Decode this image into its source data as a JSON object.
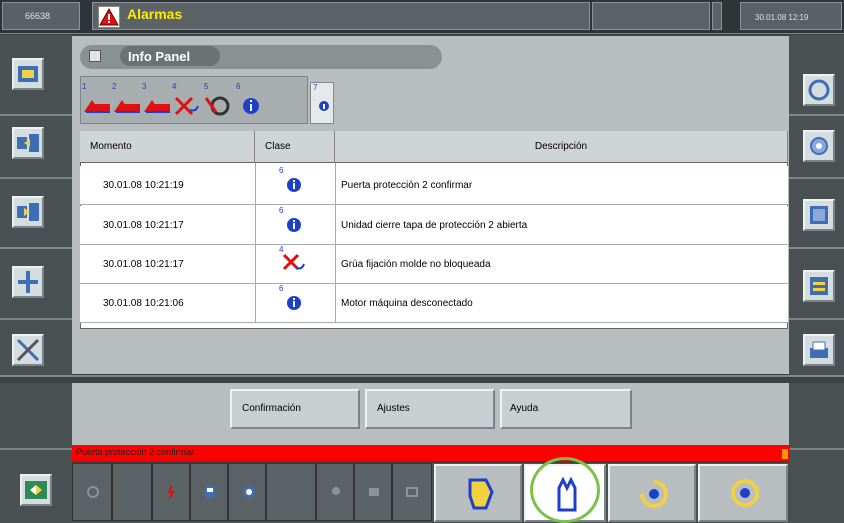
{
  "topbar": {
    "machine_id": "66638",
    "title": "Alarmas",
    "datetime": "30.01.08 12:19"
  },
  "panel": {
    "title": "Info Panel",
    "tab_numbers": [
      "1",
      "2",
      "3",
      "4",
      "5",
      "6",
      "7"
    ]
  },
  "table": {
    "headers": {
      "moment": "Momento",
      "class": "Clase",
      "description": "Descripción"
    },
    "rows": [
      {
        "moment": "30.01.08 10:21:19",
        "class_num": "6",
        "class_icon": "info-icon",
        "description": "Puerta protección 2 confirmar"
      },
      {
        "moment": "30.01.08 10:21:17",
        "class_num": "6",
        "class_icon": "info-icon",
        "description": "Unidad cierre tapa de protección 2 abierta"
      },
      {
        "moment": "30.01.08 10:21:17",
        "class_num": "4",
        "class_icon": "crane-warning-icon",
        "description": "Grúa fijación molde no bloqueada"
      },
      {
        "moment": "30.01.08 10:21:06",
        "class_num": "6",
        "class_icon": "info-icon",
        "description": "Motor máquina desconectado"
      }
    ]
  },
  "commands": {
    "confirm": "Confirmación",
    "settings": "Ajustes",
    "help": "Ayuda"
  },
  "status_message": "Puerta protección 2 confirmar",
  "colors": {
    "accent_yellow": "#ffea00",
    "alarm_red": "#ff0000",
    "highlight_green": "#7cc24a",
    "info_blue": "#1e40c8"
  }
}
